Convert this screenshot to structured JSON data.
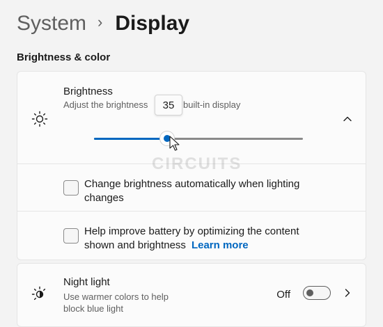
{
  "breadcrumb": {
    "parent": "System",
    "separator": "›",
    "current": "Display"
  },
  "section": {
    "title": "Brightness & color"
  },
  "brightness": {
    "icon": "sun-icon",
    "title": "Brightness",
    "description_left": "Adjust the brightness",
    "description_right": "built-in display",
    "value": 35,
    "value_text": "35",
    "expanded": true,
    "chevron_icon": "chevron-up-icon"
  },
  "options": [
    {
      "label_line1": "Change brightness automatically when lighting",
      "label_line2": "changes",
      "checked": false
    },
    {
      "label_line1": "Help improve battery by optimizing the content",
      "label_line2": "shown and brightness",
      "link": "Learn more",
      "checked": false
    }
  ],
  "night_light": {
    "icon": "night-light-icon",
    "title": "Night light",
    "description": "Use warmer colors to help block blue light",
    "state": "Off",
    "on": false,
    "chevron_icon": "chevron-right-icon"
  },
  "watermark": "CIRCUITS",
  "colors": {
    "accent": "#0067c0",
    "background": "#f3f3f3",
    "card": "#fbfbfb"
  }
}
